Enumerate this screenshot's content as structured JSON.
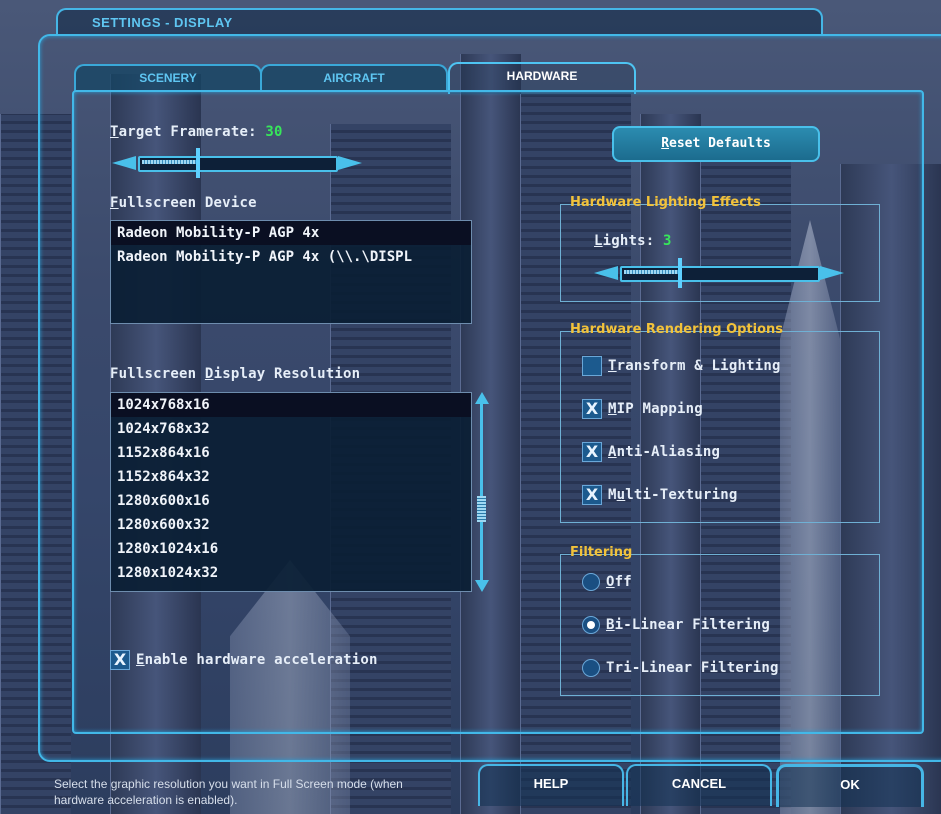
{
  "window": {
    "title": "SETTINGS - DISPLAY"
  },
  "tabs": [
    {
      "label": "SCENERY",
      "active": false
    },
    {
      "label": "AIRCRAFT",
      "active": false
    },
    {
      "label": "HARDWARE",
      "active": true
    }
  ],
  "framerate": {
    "label_first": "T",
    "label_rest": "arget Framerate: ",
    "value": "30",
    "level": 0.3
  },
  "fullscreen_device": {
    "label_first": "F",
    "label_rest": "ullscreen Device",
    "items": [
      {
        "text": "Radeon Mobility-P AGP 4x",
        "selected": true
      },
      {
        "text": "Radeon Mobility-P AGP 4x (\\\\.\\DISPL",
        "selected": false
      }
    ]
  },
  "resolution": {
    "label_pre": "Fullscreen ",
    "label_u": "D",
    "label_post": "isplay Resolution",
    "items": [
      {
        "text": "1024x768x16",
        "selected": true
      },
      {
        "text": "1024x768x32",
        "selected": false
      },
      {
        "text": "1152x864x16",
        "selected": false
      },
      {
        "text": "1152x864x32",
        "selected": false
      },
      {
        "text": "1280x600x16",
        "selected": false
      },
      {
        "text": "1280x600x32",
        "selected": false
      },
      {
        "text": "1280x1024x16",
        "selected": false
      },
      {
        "text": "1280x1024x32",
        "selected": false
      }
    ]
  },
  "hardware_accel": {
    "checked": true,
    "label_first": "E",
    "label_rest": "nable hardware acceleration",
    "mark": "X"
  },
  "reset_button": {
    "label_first": "R",
    "label_rest": "eset Defaults"
  },
  "lighting": {
    "title": "Hardware Lighting Effects",
    "lights_first": "L",
    "lights_rest": "ights: ",
    "value": "3",
    "level": 0.3
  },
  "rendering": {
    "title": "Hardware Rendering Options",
    "options": [
      {
        "checked": false,
        "pre": "",
        "u": "T",
        "post": "ransform & Lighting",
        "mark": ""
      },
      {
        "checked": true,
        "pre": "",
        "u": "M",
        "post": "IP Mapping",
        "mark": "X"
      },
      {
        "checked": true,
        "pre": "",
        "u": "A",
        "post": "nti-Aliasing",
        "mark": "X"
      },
      {
        "checked": true,
        "pre": "M",
        "u": "u",
        "post": "lti-Texturing",
        "mark": "X"
      }
    ]
  },
  "filtering": {
    "title": "Filtering",
    "options": [
      {
        "selected": false,
        "u": "O",
        "post": "ff"
      },
      {
        "selected": true,
        "u": "B",
        "post": "i-Linear Filtering"
      },
      {
        "selected": false,
        "u": "",
        "post": "Tri-Linear Filtering"
      }
    ]
  },
  "footer": {
    "status_text": "Select the graphic resolution you want in Full Screen mode (when hardware acceleration is enabled).",
    "help_label": "HELP",
    "cancel_label": "CANCEL",
    "ok_label": "OK"
  },
  "colors": {
    "accent": "#42b8e8",
    "value_green": "#37e65a",
    "group_title": "#f2c23a"
  }
}
